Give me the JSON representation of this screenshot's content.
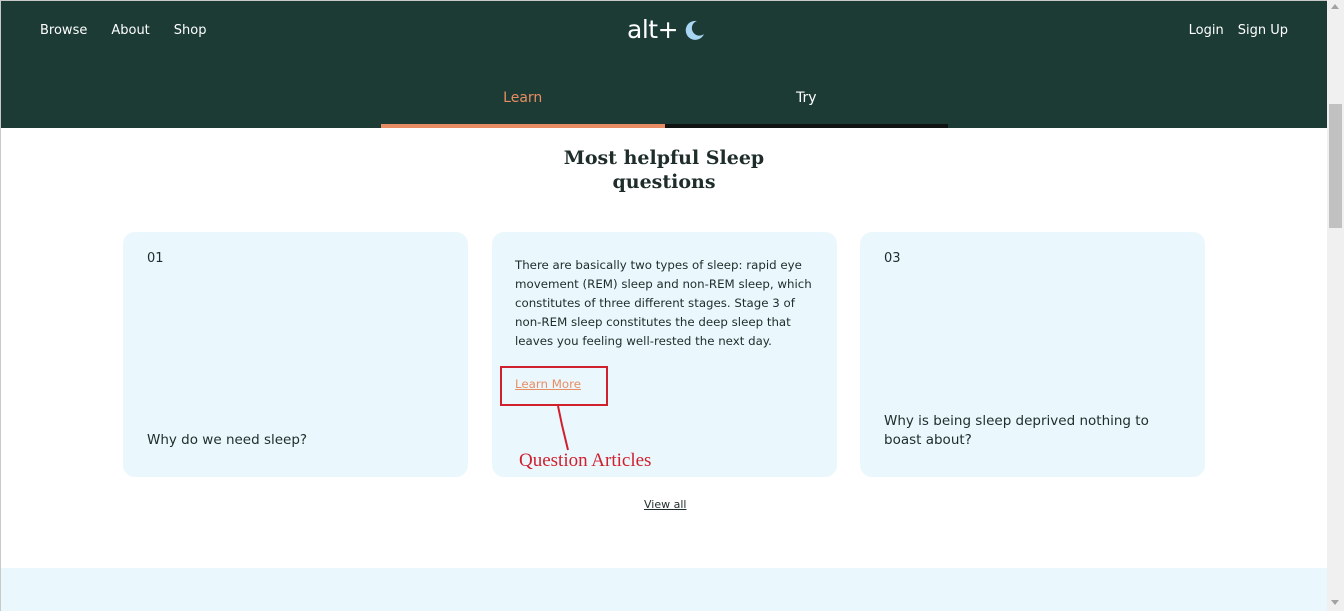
{
  "header": {
    "nav_left": [
      "Browse",
      "About",
      "Shop"
    ],
    "logo_text": "alt+",
    "logo_icon": "moon-icon",
    "nav_right": [
      "Login",
      "Sign Up"
    ],
    "tabs": [
      {
        "label": "Learn",
        "active": true
      },
      {
        "label": "Try",
        "active": false
      }
    ],
    "colors": {
      "background": "#1b3b34",
      "accent": "#e88d63"
    }
  },
  "main": {
    "title_line1": "Most helpful Sleep",
    "title_line2": "questions",
    "cards": [
      {
        "number": "01",
        "question": "Why do we need sleep?"
      },
      {
        "answer": "There are basically two types of sleep: rapid eye movement (REM) sleep and non-REM sleep, which constitutes of three different stages. Stage 3 of non-REM sleep constitutes the deep sleep that leaves you feeling well-rested the next day.",
        "link": "Learn More"
      },
      {
        "number": "03",
        "question": "Why is being sleep deprived nothing to boast about?"
      }
    ],
    "view_all": "View all",
    "card_color": "#eaf7fd"
  },
  "annotation": {
    "label": "Question Articles",
    "color": "#d0202e"
  }
}
